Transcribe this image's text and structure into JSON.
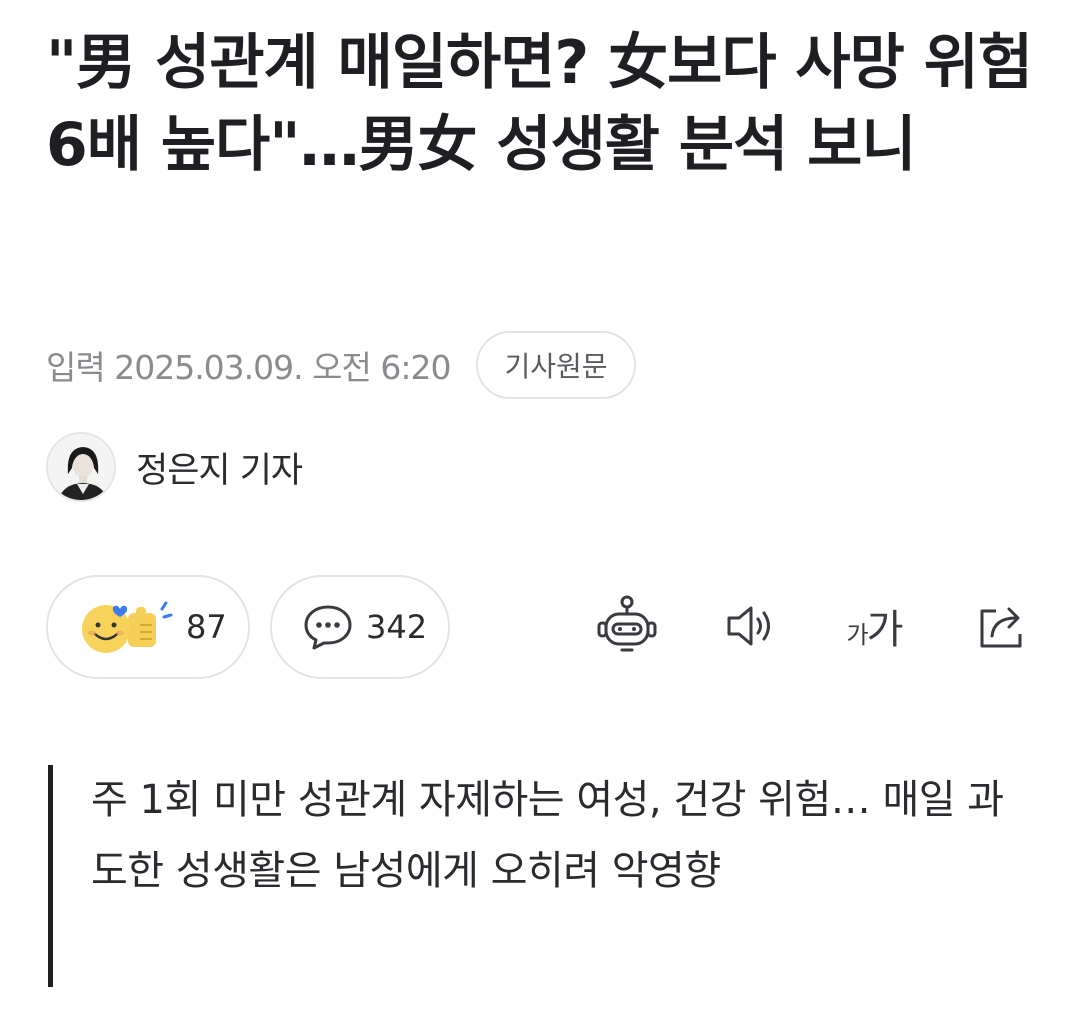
{
  "article": {
    "headline": "\"男 성관계 매일하면? 女보다 사망 위험 6배 높다\"…男女 성생활 분석 보니",
    "published": "입력 2025.03.09. 오전 6:20",
    "origin_button": "기사원문",
    "reporter": "정은지 기자",
    "summary": "주 1회 미만 성관계 자제하는 여성, 건강 위험… 매일 과도한 성생활은 남성에게 오히려 악영향"
  },
  "actions": {
    "reaction_count": "87",
    "comment_count": "342",
    "fontsize_small": "가",
    "fontsize_large": "가"
  },
  "icons": {
    "reaction": "emoji-thumbs-up-icon",
    "comment": "speech-bubble-icon",
    "summary_bot": "robot-icon",
    "tts": "speaker-icon",
    "fontsize": "font-size-icon",
    "share": "share-icon"
  },
  "colors": {
    "text": "#1e1e23",
    "meta": "#8a8a8f",
    "border": "#e3e3e6",
    "emoji_yellow": "#f7d35c",
    "heart_blue": "#3d7bf0"
  }
}
